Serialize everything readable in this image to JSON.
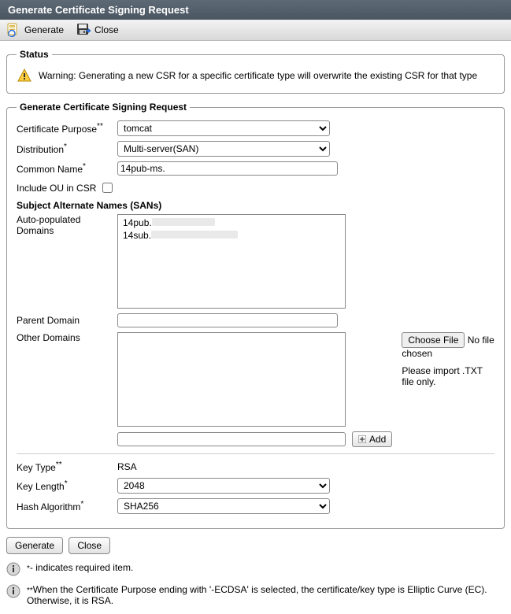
{
  "titlebar": "Generate Certificate Signing Request",
  "toolbar": {
    "generate": "Generate",
    "close": "Close"
  },
  "status": {
    "legend": "Status",
    "warning": "Warning: Generating a new CSR for a specific certificate type will overwrite the existing CSR for that type"
  },
  "csr": {
    "legend": "Generate Certificate Signing Request",
    "cert_purpose_label": "Certificate Purpose",
    "cert_purpose_value": "tomcat",
    "distribution_label": "Distribution",
    "distribution_value": "Multi-server(SAN)",
    "common_name_label": "Common Name",
    "common_name_value": "14pub-ms.",
    "include_ou_label": "Include OU in CSR",
    "sans_heading": "Subject Alternate Names (SANs)",
    "auto_pop_label": "Auto-populated Domains",
    "domains": [
      "14pub.",
      "14sub."
    ],
    "parent_domain_label": "Parent Domain",
    "parent_domain_value": "",
    "other_domains_label": "Other Domains",
    "choose_file": "Choose File",
    "no_file": "No file chosen",
    "import_hint": "Please import .TXT file only.",
    "add_label": "Add",
    "key_type_label": "Key Type",
    "key_type_value": "RSA",
    "key_length_label": "Key Length",
    "key_length_value": "2048",
    "hash_label": "Hash Algorithm",
    "hash_value": "SHA256"
  },
  "buttons": {
    "generate": "Generate",
    "close": "Close"
  },
  "notes": {
    "star": "- indicates required item.",
    "dblstar": "When the Certificate Purpose ending with '-ECDSA' is selected, the certificate/key type is Elliptic Curve (EC). Otherwise, it is RSA."
  }
}
